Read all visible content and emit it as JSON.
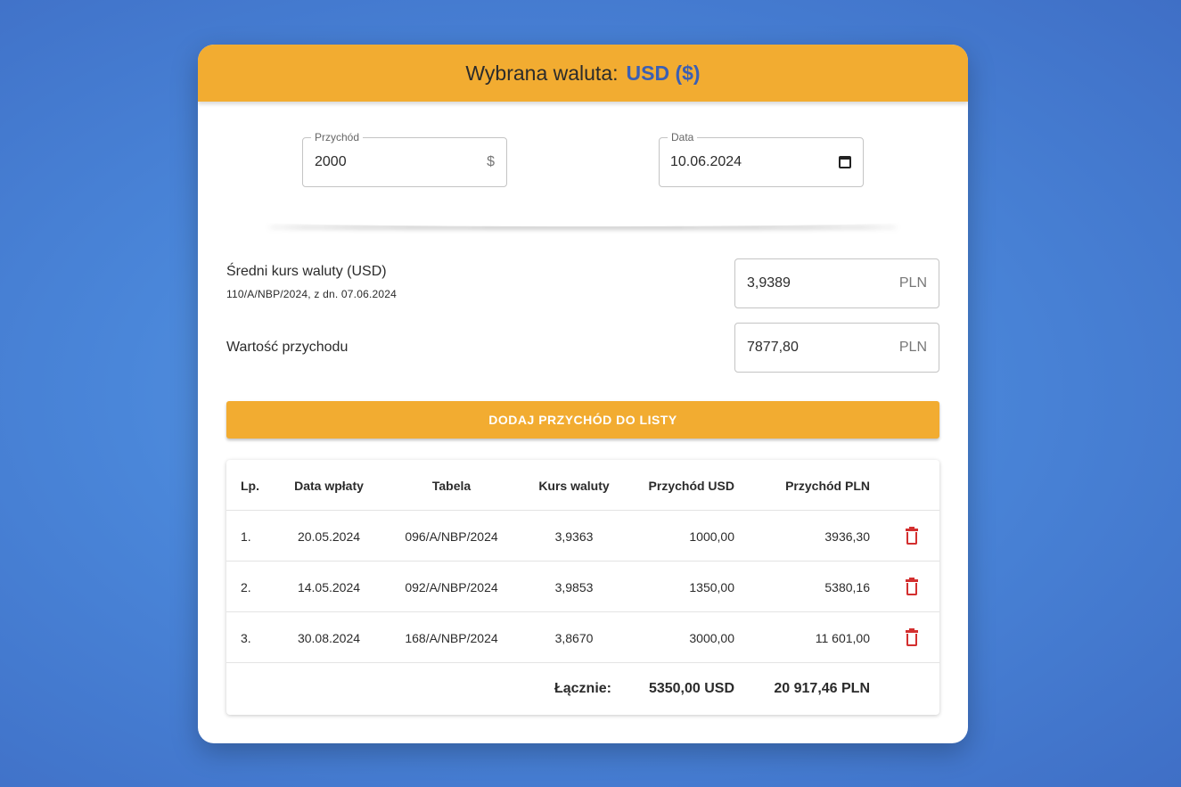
{
  "header": {
    "prefix": "Wybrana waluta:",
    "currency": "USD ($)"
  },
  "income_field": {
    "label": "Przychód",
    "value": "2000",
    "suffix": "$"
  },
  "date_field": {
    "label": "Data",
    "value": "10.06.2024"
  },
  "rate": {
    "label": "Średni kurs waluty (USD)",
    "source": "110/A/NBP/2024, z dn. 07.06.2024",
    "value": "3,9389",
    "unit": "PLN"
  },
  "income_value": {
    "label": "Wartość przychodu",
    "value": "7877,80",
    "unit": "PLN"
  },
  "add_button": {
    "label": "DODAJ PRZYCHÓD DO LISTY"
  },
  "table": {
    "headers": {
      "lp": "Lp.",
      "date": "Data wpłaty",
      "table": "Tabela",
      "rate": "Kurs waluty",
      "usd": "Przychód USD",
      "pln": "Przychód PLN"
    },
    "rows": [
      {
        "lp": "1.",
        "date": "20.05.2024",
        "table": "096/A/NBP/2024",
        "rate": "3,9363",
        "usd": "1000,00",
        "pln": "3936,30"
      },
      {
        "lp": "2.",
        "date": "14.05.2024",
        "table": "092/A/NBP/2024",
        "rate": "3,9853",
        "usd": "1350,00",
        "pln": "5380,16"
      },
      {
        "lp": "3.",
        "date": "30.08.2024",
        "table": "168/A/NBP/2024",
        "rate": "3,8670",
        "usd": "3000,00",
        "pln": "11 601,00"
      }
    ],
    "footer": {
      "label": "Łącznie:",
      "usd": "5350,00 USD",
      "pln": "20 917,46 PLN"
    }
  },
  "icons": {
    "delete": "trash-icon",
    "calendar": "calendar-icon"
  },
  "colors": {
    "accent": "#f2ac31",
    "currency": "#3b5fb3",
    "delete": "#d32f2f"
  }
}
